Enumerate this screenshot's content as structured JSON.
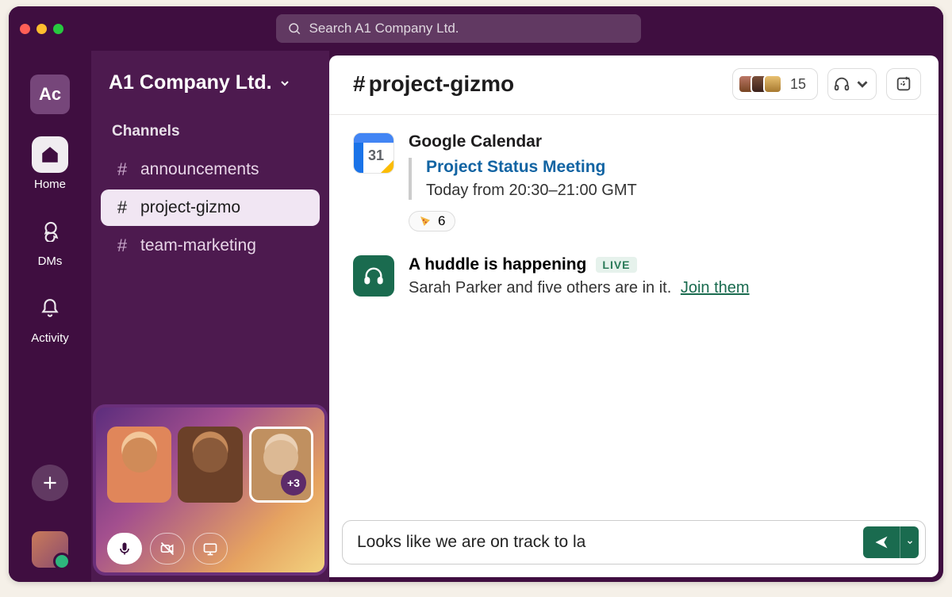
{
  "workspace": {
    "badge": "Ac",
    "name": "A1 Company Ltd."
  },
  "search": {
    "placeholder": "Search A1 Company Ltd."
  },
  "rail": {
    "items": [
      {
        "label": "Home"
      },
      {
        "label": "DMs"
      },
      {
        "label": "Activity"
      }
    ]
  },
  "sidebar": {
    "section_title": "Channels",
    "channels": [
      {
        "hash": "#",
        "name": "announcements"
      },
      {
        "hash": "#",
        "name": "project-gizmo"
      },
      {
        "hash": "#",
        "name": "team-marketing"
      }
    ]
  },
  "huddle_widget": {
    "extra_badge": "+3"
  },
  "channel_header": {
    "hash": "#",
    "name": "project-gizmo",
    "member_count": "15"
  },
  "calendar_message": {
    "author": "Google Calendar",
    "day_number": "31",
    "event_title": "Project Status Meeting",
    "event_time": "Today from 20:30–21:00 GMT",
    "reaction_count": "6"
  },
  "huddle_message": {
    "title": "A huddle is happening",
    "live_label": "LIVE",
    "subtext": "Sarah Parker and five others are in it.",
    "join_label": "Join them"
  },
  "composer": {
    "value": "Looks like we are on track to la"
  }
}
